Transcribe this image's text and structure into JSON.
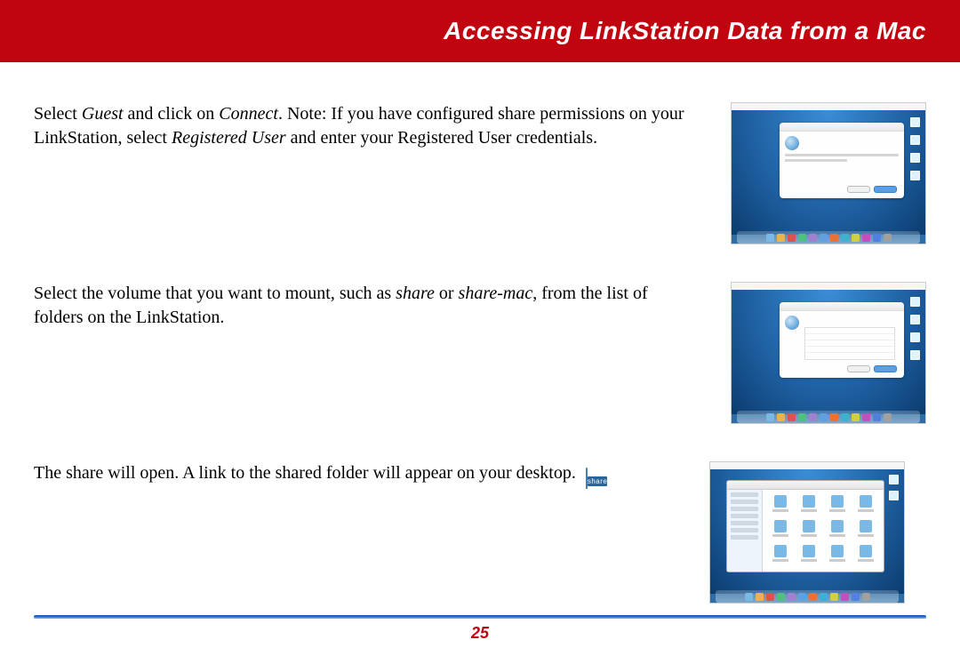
{
  "header": {
    "title": "Accessing LinkStation Data from a Mac"
  },
  "rows": [
    {
      "text_pre": "Select ",
      "em1": "Guest",
      "text_mid1": " and click on ",
      "em2": "Connect",
      "text_mid2": ".  Note:  If you have configured share permissions on your LinkStation, select ",
      "em3": "Registered User",
      "text_post": " and enter your Registered User credentials."
    },
    {
      "text_pre": "Select the volume that you want to mount, such as ",
      "em1": "share",
      "text_mid1": " or ",
      "em2": "share-mac",
      "text_post": ", from the list of folders on the LinkStation."
    },
    {
      "text": "The share will open.  A link to the shared folder will appear on your desktop.",
      "icon_label": "share"
    }
  ],
  "page_number": "25"
}
